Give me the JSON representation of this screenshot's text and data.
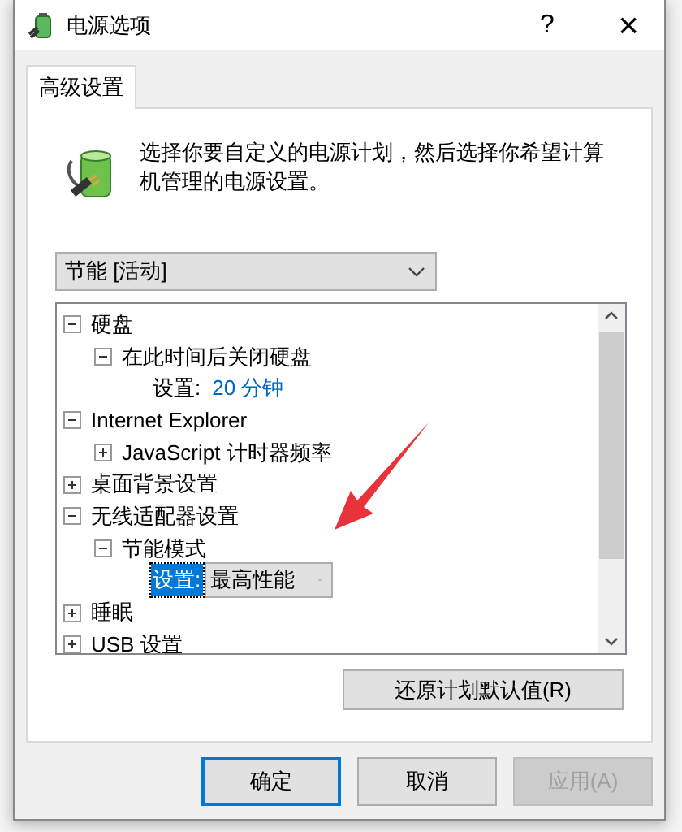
{
  "window": {
    "title": "电源选项",
    "help": "?",
    "close": "×"
  },
  "tabs": [
    {
      "label": "高级设置",
      "selected": true
    }
  ],
  "description": "选择你要自定义的电源计划，然后选择你希望计算机管理的电源设置。",
  "plan_select": {
    "value": "节能 [活动]"
  },
  "tree": {
    "items": [
      {
        "label": "硬盘",
        "expanded": true,
        "children": [
          {
            "label": "在此时间后关闭硬盘",
            "expanded": true,
            "children": [
              {
                "kind": "setting",
                "label": "设置:",
                "value": "20 分钟",
                "selected": false
              }
            ]
          }
        ]
      },
      {
        "label": "Internet Explorer",
        "expanded": true,
        "children": [
          {
            "label": "JavaScript 计时器频率",
            "expanded": false
          }
        ]
      },
      {
        "label": "桌面背景设置",
        "expanded": false
      },
      {
        "label": "无线适配器设置",
        "expanded": true,
        "children": [
          {
            "label": "节能模式",
            "expanded": true,
            "children": [
              {
                "kind": "setting_dropdown",
                "label": "设置:",
                "value": "最高性能",
                "selected": true
              }
            ]
          }
        ]
      },
      {
        "label": "睡眠",
        "expanded": false
      },
      {
        "label": "USB 设置",
        "expanded": false
      }
    ]
  },
  "restore_button": "还原计划默认值(R)",
  "buttons": [
    {
      "label": "确定",
      "kind": "default",
      "disabled": false
    },
    {
      "label": "取消",
      "kind": "normal",
      "disabled": false
    },
    {
      "label": "应用(A)",
      "kind": "normal",
      "disabled": true
    }
  ]
}
